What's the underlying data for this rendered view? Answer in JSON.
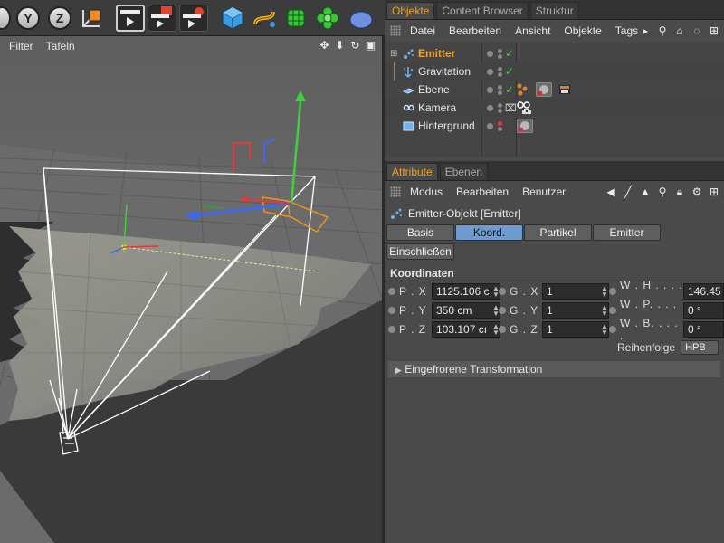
{
  "toolbar": {
    "buttons": [
      {
        "icon": "x-axis-lock-icon",
        "letter": ""
      },
      {
        "icon": "y-axis-lock-icon",
        "letter": "Y"
      },
      {
        "icon": "z-axis-lock-icon",
        "letter": "Z"
      },
      {
        "icon": "coordinate-system-icon",
        "letter": ""
      },
      {
        "icon": "render-view-icon",
        "letter": ""
      },
      {
        "icon": "render-picture-viewer-icon",
        "letter": ""
      },
      {
        "icon": "render-settings-icon",
        "letter": ""
      },
      {
        "icon": "cube-primitive-icon",
        "letter": ""
      },
      {
        "icon": "spline-pen-icon",
        "letter": ""
      },
      {
        "icon": "subdivision-surface-icon",
        "letter": ""
      },
      {
        "icon": "cloner-icon",
        "letter": ""
      },
      {
        "icon": "deformer-icon",
        "letter": ""
      }
    ]
  },
  "viewport": {
    "menu": [
      "Filter",
      "Tafeln"
    ],
    "icons": [
      "move-view-icon",
      "zoom-view-icon",
      "rotate-view-icon",
      "toggle-view-icon"
    ]
  },
  "object_manager": {
    "tabs": [
      "Objekte",
      "Content Browser",
      "Struktur"
    ],
    "menu": [
      "Datei",
      "Bearbeiten",
      "Ansicht",
      "Objekte",
      "Tags"
    ],
    "objects": [
      {
        "name": "Emitter",
        "selected": true,
        "icon": "emitter-icon",
        "check": true
      },
      {
        "name": "Gravitation",
        "selected": false,
        "icon": "gravity-icon",
        "check": true
      },
      {
        "name": "Ebene",
        "selected": false,
        "icon": "plane-icon",
        "check": true
      },
      {
        "name": "Kamera",
        "selected": false,
        "icon": "camera-icon",
        "check": false
      },
      {
        "name": "Hintergrund",
        "selected": false,
        "icon": "background-icon",
        "check": false
      }
    ]
  },
  "attribute_manager": {
    "tabs": [
      "Attribute",
      "Ebenen"
    ],
    "menu": [
      "Modus",
      "Bearbeiten",
      "Benutzer"
    ],
    "title": "Emitter-Objekt [Emitter]",
    "segments": [
      "Basis",
      "Koord.",
      "Partikel",
      "Emitter"
    ],
    "segment_extra": "Einschließen",
    "active_segment": "Koord.",
    "section": "Koordinaten",
    "fields": {
      "px_label": "P . X",
      "px": "1125.106 c",
      "py_label": "P . Y",
      "py": "350 cm",
      "pz_label": "P . Z",
      "pz": "103.107 cı",
      "gx_label": "G . X",
      "gx": "1",
      "gy_label": "G . Y",
      "gy": "1",
      "gz_label": "G . Z",
      "gz": "1",
      "wh_label": "W . H . . . . .",
      "wh": "146.45",
      "wp_label": "W . P. . . . .",
      "wp": "0 °",
      "wb_label": "W . B. . . . .",
      "wb": "0 °"
    },
    "order_label": "Reihenfolge",
    "order_value": "HPB",
    "frozen": "Eingefrorene Transformation"
  },
  "colors": {
    "accent": "#f4a024",
    "selected_segment": "#6d9bd0",
    "check": "#3fd03f"
  }
}
